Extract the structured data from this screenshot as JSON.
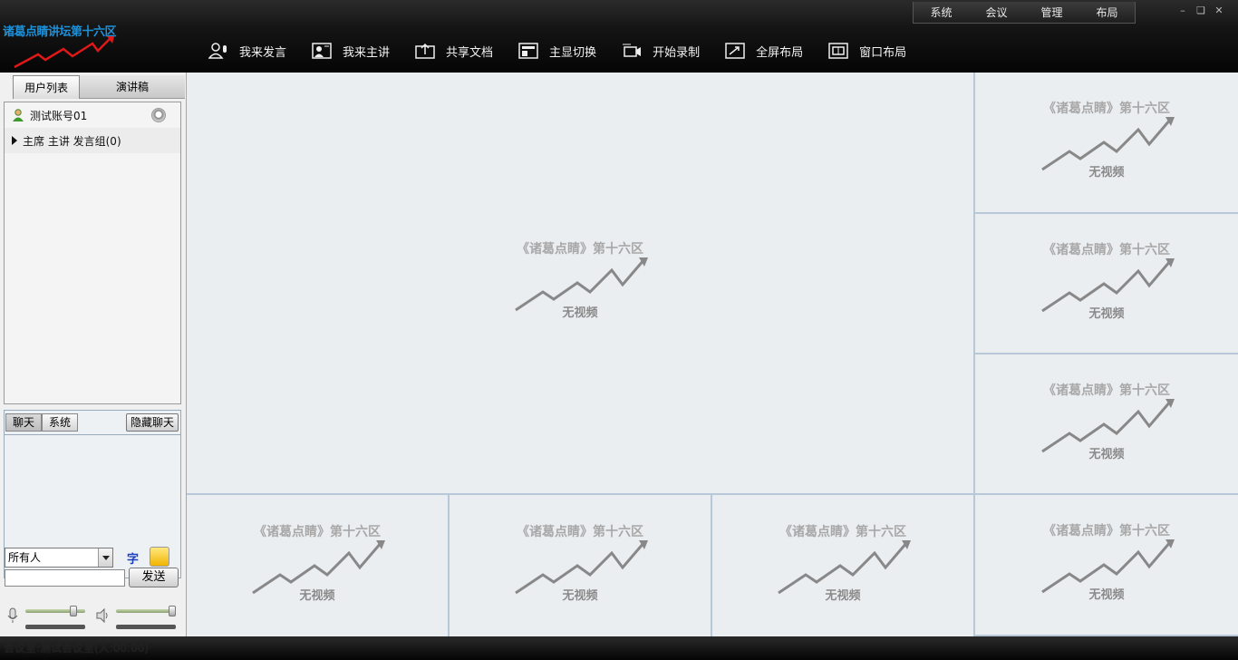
{
  "app": {
    "logo_text": "诸葛点睛讲坛第十六区"
  },
  "system_menu": [
    "系统",
    "会议",
    "管理",
    "布局"
  ],
  "window_controls": [
    "minimize-icon",
    "restore-icon",
    "close-icon"
  ],
  "toolbar": [
    {
      "label": "我来发言",
      "icon": "speak-icon"
    },
    {
      "label": "我来主讲",
      "icon": "presenter-icon"
    },
    {
      "label": "共享文档",
      "icon": "share-doc-icon"
    },
    {
      "label": "主显切换",
      "icon": "switch-display-icon"
    },
    {
      "label": "开始录制",
      "icon": "record-icon"
    },
    {
      "label": "全屏布局",
      "icon": "fullscreen-icon"
    },
    {
      "label": "窗口布局",
      "icon": "window-layout-icon"
    }
  ],
  "left_tabs": {
    "users": "用户列表",
    "speech": "演讲稿"
  },
  "users": [
    {
      "name": "测试账号01"
    }
  ],
  "groups": [
    {
      "label": "主席 主讲 发言组(0)"
    }
  ],
  "chat": {
    "tab_chat": "聊天",
    "tab_system": "系统",
    "hide_label": "隐藏聊天",
    "recipient": "所有人",
    "font_label": "字",
    "send_label": "发送",
    "message_value": ""
  },
  "audio": {
    "mic_level": 0.85,
    "speaker_level": 1.0
  },
  "video_cells": [
    {
      "id": "main",
      "title": "《诸葛点睛》第十六区",
      "status": "无视频"
    },
    {
      "id": "r1",
      "title": "《诸葛点睛》第十六区",
      "status": "无视频"
    },
    {
      "id": "r2",
      "title": "《诸葛点睛》第十六区",
      "status": "无视频"
    },
    {
      "id": "r3",
      "title": "《诸葛点睛》第十六区",
      "status": "无视频"
    },
    {
      "id": "b1",
      "title": "《诸葛点睛》第十六区",
      "status": "无视频"
    },
    {
      "id": "b2",
      "title": "《诸葛点睛》第十六区",
      "status": "无视频"
    },
    {
      "id": "b3",
      "title": "《诸葛点睛》第十六区",
      "status": "无视频"
    },
    {
      "id": "b4",
      "title": "《诸葛点睛》第十六区",
      "status": "无视频"
    }
  ],
  "status_bar": "会议室:测试会议室(人:00:00)"
}
